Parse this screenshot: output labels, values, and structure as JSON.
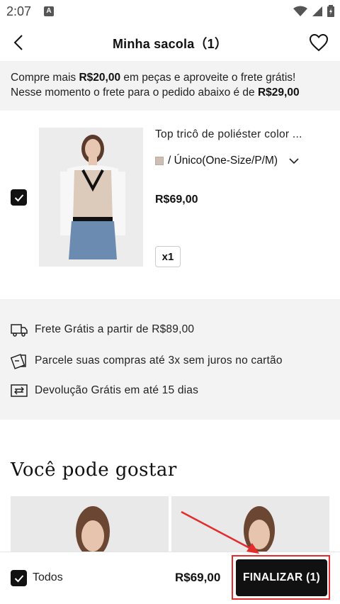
{
  "status_bar": {
    "time": "2:07",
    "app_badge": "A"
  },
  "header": {
    "title": "Minha sacola（1）"
  },
  "shipping_banner": {
    "line1_prefix": "Compre mais ",
    "line1_amount": "R$20,00",
    "line1_suffix": " em peças e aproveite o frete grátis!",
    "line2_prefix": "Nesse momento o frete para o pedido abaixo é de ",
    "line2_amount": "R$29,00"
  },
  "cart_item": {
    "title": "Top tricô de poliéster color ...",
    "variant": "/ Único(One-Size/P/M)",
    "price": "R$69,00",
    "quantity": "x1",
    "checked": true
  },
  "benefits": [
    {
      "icon": "truck-icon",
      "text": "Frete Grátis a partir de R$89,00"
    },
    {
      "icon": "card-installment-icon",
      "text": "Parcele suas compras até 3x sem juros no cartão"
    },
    {
      "icon": "return-box-icon",
      "text": "Devolução Grátis em até 15 dias"
    }
  ],
  "recommendations": {
    "title": "Você pode gostar"
  },
  "bottom_bar": {
    "select_all_label": "Todos",
    "total": "R$69,00",
    "checkout_label": "FINALIZAR (1)"
  },
  "colors": {
    "accent": "#111111",
    "highlight": "#e52b2b",
    "banner_bg": "#f3f3f3"
  }
}
